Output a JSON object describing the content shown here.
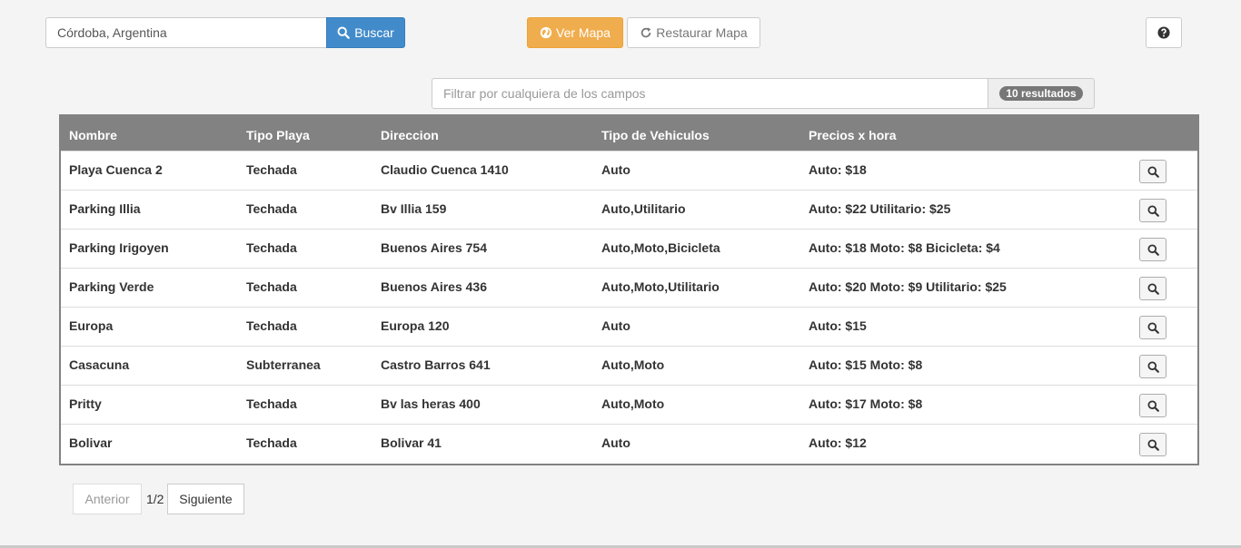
{
  "search": {
    "value": "Córdoba, Argentina",
    "button_label": "Buscar"
  },
  "map_buttons": {
    "show_label": "Ver Mapa",
    "restore_label": "Restaurar Mapa"
  },
  "filter": {
    "placeholder": "Filtrar por cualquiera de los campos",
    "results_badge": "10 resultados"
  },
  "table": {
    "headers": [
      "Nombre",
      "Tipo Playa",
      "Direccion",
      "Tipo de Vehiculos",
      "Precios x hora"
    ],
    "rows": [
      [
        "Playa Cuenca 2",
        "Techada",
        "Claudio Cuenca 1410",
        "Auto",
        "Auto: $18"
      ],
      [
        "Parking Illia",
        "Techada",
        "Bv Illia 159",
        "Auto,Utilitario",
        "Auto: $22 Utilitario: $25"
      ],
      [
        "Parking Irigoyen",
        "Techada",
        "Buenos Aires 754",
        "Auto,Moto,Bicicleta",
        "Auto: $18 Moto: $8 Bicicleta: $4"
      ],
      [
        "Parking Verde",
        "Techada",
        "Buenos Aires 436",
        "Auto,Moto,Utilitario",
        "Auto: $20 Moto: $9 Utilitario: $25"
      ],
      [
        "Europa",
        "Techada",
        "Europa 120",
        "Auto",
        "Auto: $15"
      ],
      [
        "Casacuna",
        "Subterranea",
        "Castro Barros 641",
        "Auto,Moto",
        "Auto: $15 Moto: $8"
      ],
      [
        "Pritty",
        "Techada",
        "Bv las heras 400",
        "Auto,Moto",
        "Auto: $17 Moto: $8"
      ],
      [
        "Bolivar",
        "Techada",
        "Bolivar 41",
        "Auto",
        "Auto: $12"
      ]
    ]
  },
  "pager": {
    "prev_label": "Anterior",
    "page_label": "1/2",
    "next_label": "Siguiente"
  },
  "icons": {
    "search": "search-icon",
    "globe": "globe-icon",
    "refresh": "refresh-icon",
    "help": "question-circle-icon",
    "view": "magnifier-icon"
  },
  "colors": {
    "primary": "#428bca",
    "warning": "#f0ad4e",
    "table_header": "#828282",
    "badge": "#777777"
  }
}
